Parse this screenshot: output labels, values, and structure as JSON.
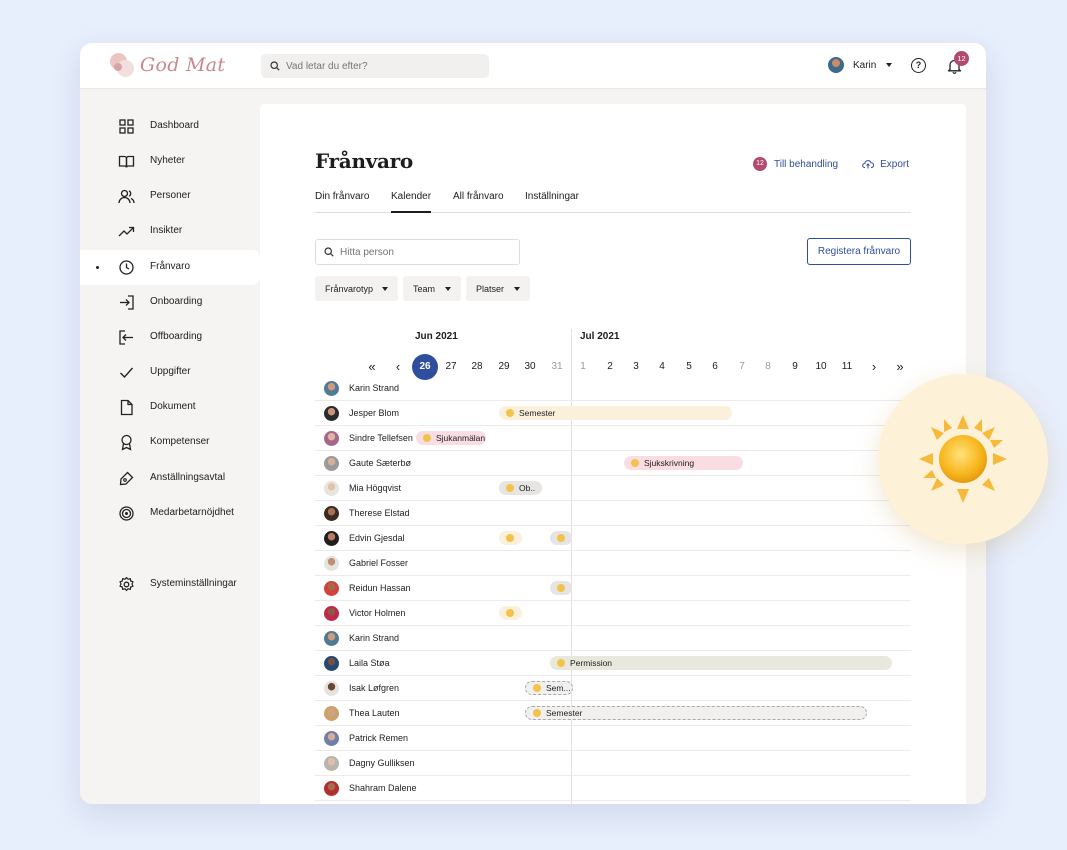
{
  "app": {
    "brand": "God Mat",
    "search_placeholder": "Vad letar du efter?",
    "user_name": "Karin",
    "notification_count": "12"
  },
  "sidebar": {
    "items": [
      {
        "label": "Dashboard",
        "icon": "grid-icon"
      },
      {
        "label": "Nyheter",
        "icon": "book-icon"
      },
      {
        "label": "Personer",
        "icon": "users-icon"
      },
      {
        "label": "Insikter",
        "icon": "trending-icon"
      },
      {
        "label": "Frånvaro",
        "icon": "clock-icon",
        "active": true
      },
      {
        "label": "Onboarding",
        "icon": "login-icon"
      },
      {
        "label": "Offboarding",
        "icon": "logout-icon"
      },
      {
        "label": "Uppgifter",
        "icon": "check-icon"
      },
      {
        "label": "Dokument",
        "icon": "document-icon"
      },
      {
        "label": "Kompetenser",
        "icon": "award-icon"
      },
      {
        "label": "Anställningsavtal",
        "icon": "pen-icon"
      },
      {
        "label": "Medarbetarnöjdhet",
        "icon": "target-icon"
      },
      {
        "label": "Systeminställningar",
        "icon": "gear-icon"
      }
    ]
  },
  "page": {
    "title": "Frånvaro",
    "pending_count": "12",
    "pending_label": "Till behandling",
    "export_label": "Export",
    "tabs": [
      "Din frånvaro",
      "Kalender",
      "All frånvaro",
      "Inställningar"
    ],
    "active_tab": "Kalender",
    "person_search_placeholder": "Hitta person",
    "register_button": "Registera frånvaro",
    "filters": [
      "Frånvarotyp",
      "Team",
      "Platser"
    ]
  },
  "calendar": {
    "months": [
      "Jun 2021",
      "Jul 2021"
    ],
    "days": [
      "26",
      "27",
      "28",
      "29",
      "30",
      "31",
      "1",
      "2",
      "3",
      "4",
      "5",
      "6",
      "7",
      "8",
      "9",
      "10",
      "11"
    ],
    "today": "26",
    "muted_days": [
      "31",
      "1",
      "7",
      "8"
    ],
    "nav": {
      "first": "«",
      "prev": "‹",
      "next": "›",
      "last": "»"
    },
    "people": [
      {
        "name": "Karin Strand",
        "events": []
      },
      {
        "name": "Jesper Blom",
        "events": [
          {
            "label": "Semester",
            "type": "semester"
          }
        ]
      },
      {
        "name": "Sindre Tellefsen",
        "events": [
          {
            "label": "Sjukanmälan",
            "type": "sjuk"
          }
        ]
      },
      {
        "name": "Gaute Sæterbø",
        "events": [
          {
            "label": "Sjukskrivning",
            "type": "sjuk"
          }
        ]
      },
      {
        "name": "Mia Högqvist",
        "events": [
          {
            "label": "Ob..",
            "type": "grey"
          }
        ]
      },
      {
        "name": "Therese Elstad",
        "events": []
      },
      {
        "name": "Edvin Gjesdal",
        "events": [
          {
            "label": "",
            "type": "semester"
          },
          {
            "label": "",
            "type": "grey"
          }
        ]
      },
      {
        "name": "Gabriel Fosser",
        "events": []
      },
      {
        "name": "Reidun Hassan",
        "events": [
          {
            "label": "",
            "type": "grey"
          }
        ]
      },
      {
        "name": "Victor Holmen",
        "events": [
          {
            "label": "",
            "type": "semester"
          }
        ]
      },
      {
        "name": "Karin Strand",
        "events": []
      },
      {
        "name": "Laila Støa",
        "events": [
          {
            "label": "Permission",
            "type": "perm"
          }
        ]
      },
      {
        "name": "Isak Løfgren",
        "events": [
          {
            "label": "Sem...",
            "type": "dashed"
          }
        ]
      },
      {
        "name": "Thea Lauten",
        "events": [
          {
            "label": "Semester",
            "type": "dashed"
          }
        ]
      },
      {
        "name": "Patrick Remen",
        "events": []
      },
      {
        "name": "Dagny Gulliksen",
        "events": []
      },
      {
        "name": "Shahram Dalene",
        "events": []
      }
    ]
  },
  "colors": {
    "accent": "#2f4e9e",
    "badge": "#b24a6e",
    "semester": "#fbf0dc",
    "sick": "#f9dde3",
    "permission": "#e9e8dc"
  },
  "decor": {
    "icon": "sun-icon"
  }
}
